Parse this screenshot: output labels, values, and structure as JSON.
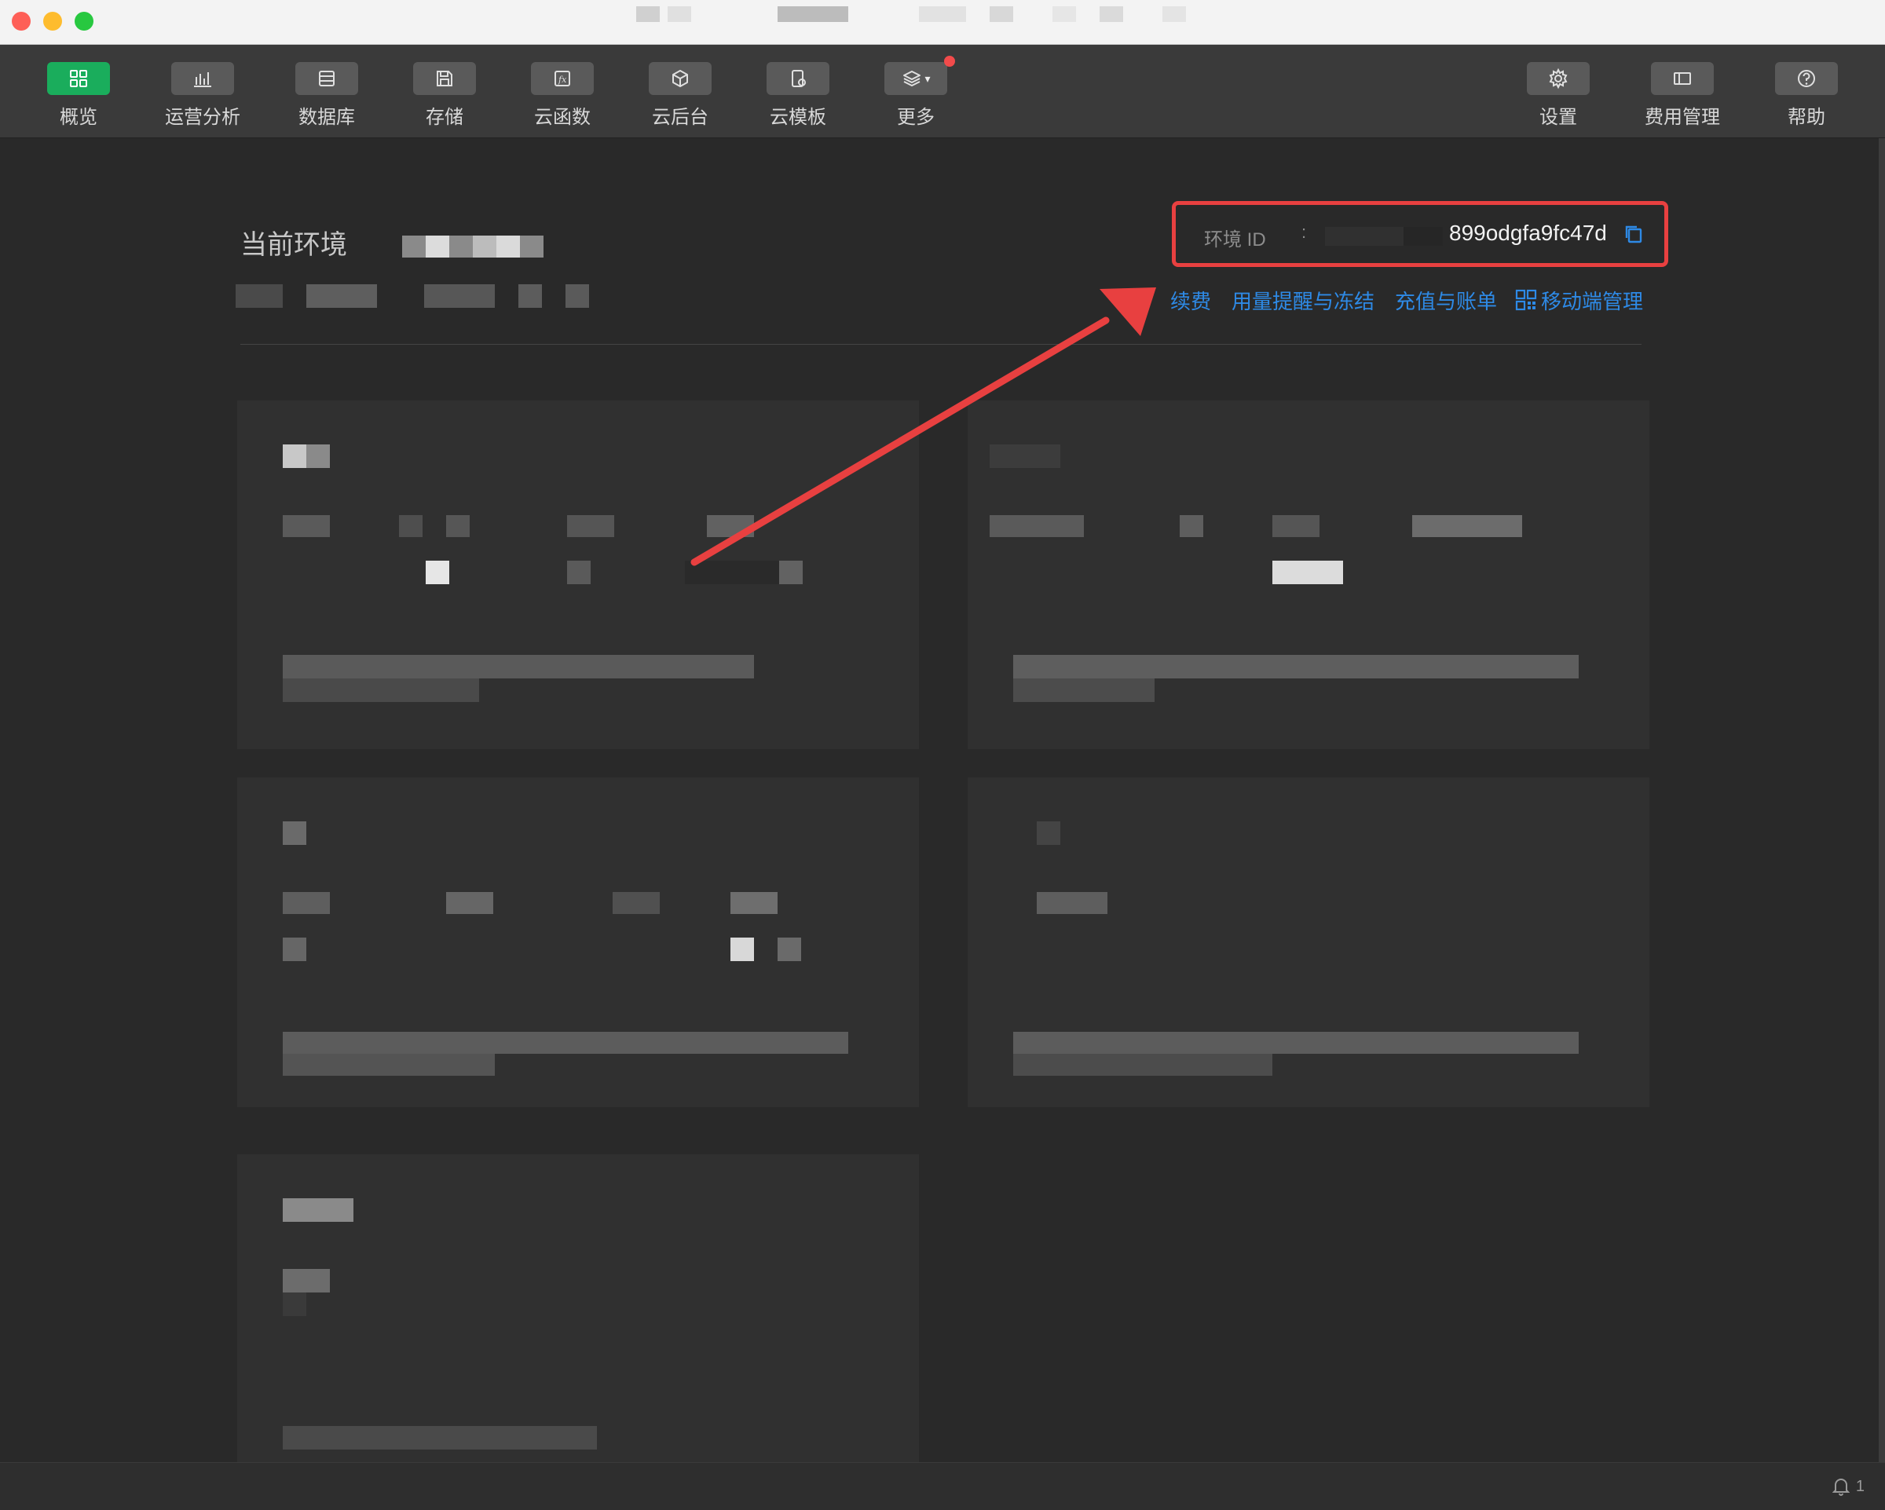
{
  "toolbar": {
    "items": [
      {
        "label": "概览",
        "icon": "overview-icon"
      },
      {
        "label": "运营分析",
        "icon": "analytics-icon"
      },
      {
        "label": "数据库",
        "icon": "database-icon"
      },
      {
        "label": "存储",
        "icon": "storage-icon"
      },
      {
        "label": "云函数",
        "icon": "function-icon"
      },
      {
        "label": "云后台",
        "icon": "cube-icon"
      },
      {
        "label": "云模板",
        "icon": "template-icon"
      },
      {
        "label": "更多",
        "icon": "layers-icon"
      }
    ],
    "right_items": [
      {
        "label": "设置",
        "icon": "gear-icon"
      },
      {
        "label": "费用管理",
        "icon": "billing-icon"
      },
      {
        "label": "帮助",
        "icon": "help-icon"
      }
    ]
  },
  "env": {
    "title": "当前环境",
    "id_label": "环境 ID",
    "id_separator": ":",
    "id_value": "899odgfa9fc47d"
  },
  "links": {
    "renew": "续费",
    "usage_alert": "用量提醒与冻结",
    "recharge": "充值与账单",
    "mobile": "移动端管理"
  },
  "status": {
    "notification_count": "1"
  },
  "colors": {
    "accent_green": "#1aad5c",
    "link_blue": "#2e8ae6",
    "highlight_red": "#e84040"
  }
}
